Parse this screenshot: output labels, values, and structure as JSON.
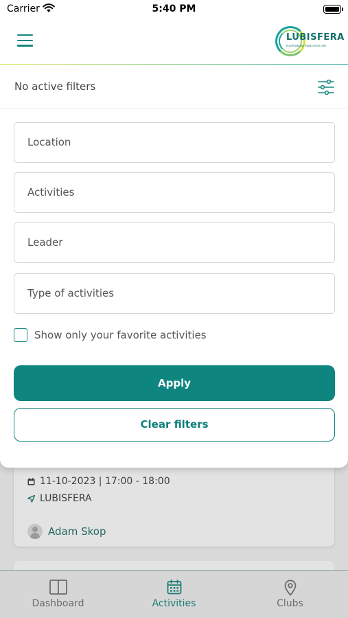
{
  "status_bar": {
    "carrier": "Carrier",
    "time": "5:40 PM"
  },
  "header": {
    "logo_text": "LUBISFERA",
    "logo_subtitle": "ROZRYWKOWY PARK SPORTOWY"
  },
  "filters": {
    "status_text": "No active filters",
    "fields": [
      {
        "label": "Location"
      },
      {
        "label": "Activities"
      },
      {
        "label": "Leader"
      },
      {
        "label": "Type of activities"
      }
    ],
    "favorite_checkbox": {
      "label": "Show only your favorite activities",
      "checked": false
    },
    "apply_label": "Apply",
    "clear_label": "Clear filters"
  },
  "activity_card": {
    "datetime": "11-10-2023 | 17:00 - 18:00",
    "location": "LUBISFERA",
    "leader": "Adam Skop"
  },
  "tabbar": {
    "tabs": [
      {
        "label": "Dashboard",
        "icon": "dashboard-icon",
        "active": false
      },
      {
        "label": "Activities",
        "icon": "calendar-icon",
        "active": true
      },
      {
        "label": "Clubs",
        "icon": "location-pin-icon",
        "active": false
      }
    ]
  },
  "colors": {
    "accent": "#0f8580",
    "accent_light": "#1aa39a",
    "logo_yellow": "#d6e03a"
  }
}
